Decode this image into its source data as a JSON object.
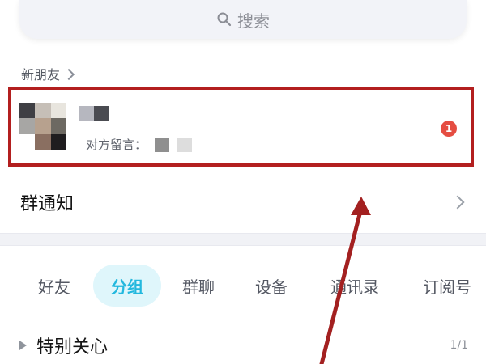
{
  "search": {
    "label": "搜索",
    "icon": "search-icon"
  },
  "new_friends": {
    "header": "新朋友",
    "request": {
      "message_label": "对方留言：",
      "badge_count": "1"
    }
  },
  "group_notice": {
    "label": "群通知"
  },
  "tabs": [
    {
      "label": "好友",
      "active": false
    },
    {
      "label": "分组",
      "active": true
    },
    {
      "label": "群聊",
      "active": false
    },
    {
      "label": "设备",
      "active": false
    },
    {
      "label": "通讯录",
      "active": false
    },
    {
      "label": "订阅号",
      "active": false
    }
  ],
  "special_care": {
    "label": "特别关心",
    "count": "1/1"
  },
  "colors": {
    "highlight_border": "#b31f1f",
    "badge": "#e54d42",
    "active_tab_bg": "#dff6fb",
    "active_tab_text": "#23b8de"
  }
}
